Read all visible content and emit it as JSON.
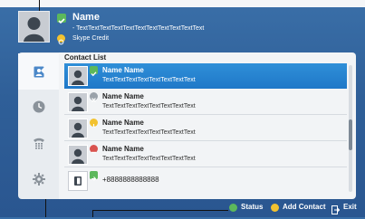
{
  "profile": {
    "name": "Name",
    "mood": "- TextTextTextTextTextTextTextTextTextTextText",
    "credit_label": "Skype Credit",
    "status_icon": "online-icon",
    "colors": {
      "online": "#5cb85c",
      "credit": "#f2c230"
    }
  },
  "sidebar": {
    "items": [
      {
        "name": "contacts-icon"
      },
      {
        "name": "history-clock-icon"
      },
      {
        "name": "dialpad-icon"
      },
      {
        "name": "settings-gear-icon"
      }
    ]
  },
  "contact_list": {
    "title": "Contact List",
    "rows": [
      {
        "name": "Name Name",
        "text": "TextTextTextTextTextTextTextText",
        "status": "online",
        "status_color": "#5cb85c"
      },
      {
        "name": "Name Name",
        "text": "TextTextTextTextTextTextTextText",
        "status": "offline",
        "status_color": "#9aa2aa"
      },
      {
        "name": "Name Name",
        "text": "TextTextTextTextTextTextTextText",
        "status": "away",
        "status_color": "#f2c230"
      },
      {
        "name": "Name Name",
        "text": "TextTextTextTextTextTextTextText",
        "status": "do-not-disturb",
        "status_color": "#d9534f"
      }
    ],
    "phone_row": {
      "number": "+8888888888888",
      "status_color": "#5cb85c"
    }
  },
  "bottom_bar": {
    "status_label": "Status",
    "add_contact_label": "Add Contact",
    "exit_label": "Exit"
  }
}
